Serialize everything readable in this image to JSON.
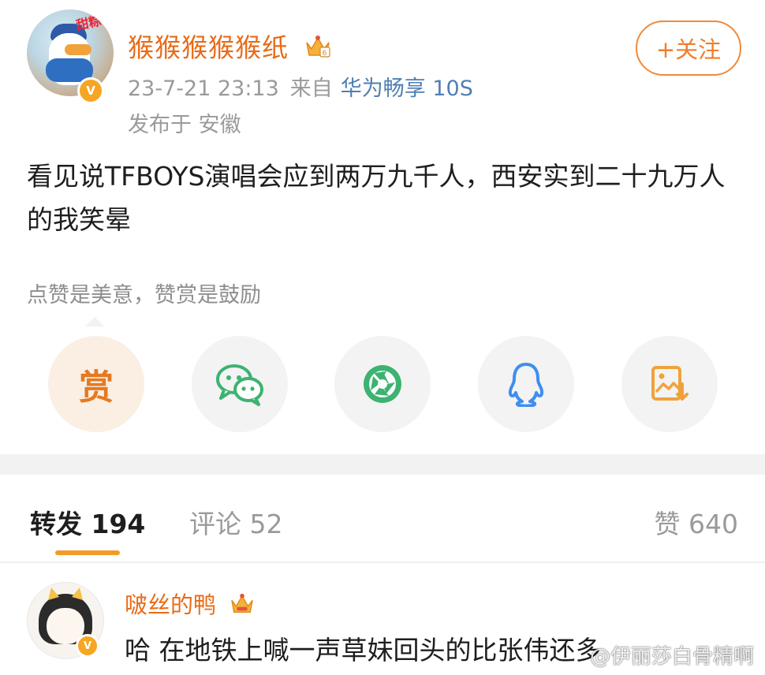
{
  "post": {
    "username": "猴猴猴猴猴纸",
    "time": "23-7-21 23:13",
    "from_label": "来自",
    "source": "华为畅享 10S",
    "location": "发布于 安徽",
    "body": "看见说TFBOYS演唱会应到两万九千人，西安实到二十九万人的我笑晕",
    "follow_label": "+关注",
    "avatar_text": "甜粽了",
    "verified_mark": "V"
  },
  "reward": {
    "hint": "点赞是美意，赞赏是鼓励",
    "reward_label": "赏"
  },
  "share_icons": [
    "reward-icon",
    "wechat-icon",
    "moments-icon",
    "qq-icon",
    "save-image-icon"
  ],
  "tabs": {
    "repost": "转发 194",
    "comments": "评论 52",
    "likes": "赞 640"
  },
  "comment": {
    "username": "啵丝的鸭",
    "text": "哈 在地铁上喊一声草妹回头的比张伟还多",
    "verified_mark": "V"
  },
  "watermark": "@伊丽莎白骨精啊",
  "colors": {
    "accent": "#e86b17",
    "link": "#4f7fb3",
    "reward_bg": "#fbefe4",
    "wechat": "#3cb371",
    "qq": "#3f8ef0",
    "tab_underline": "#f39b2a"
  }
}
